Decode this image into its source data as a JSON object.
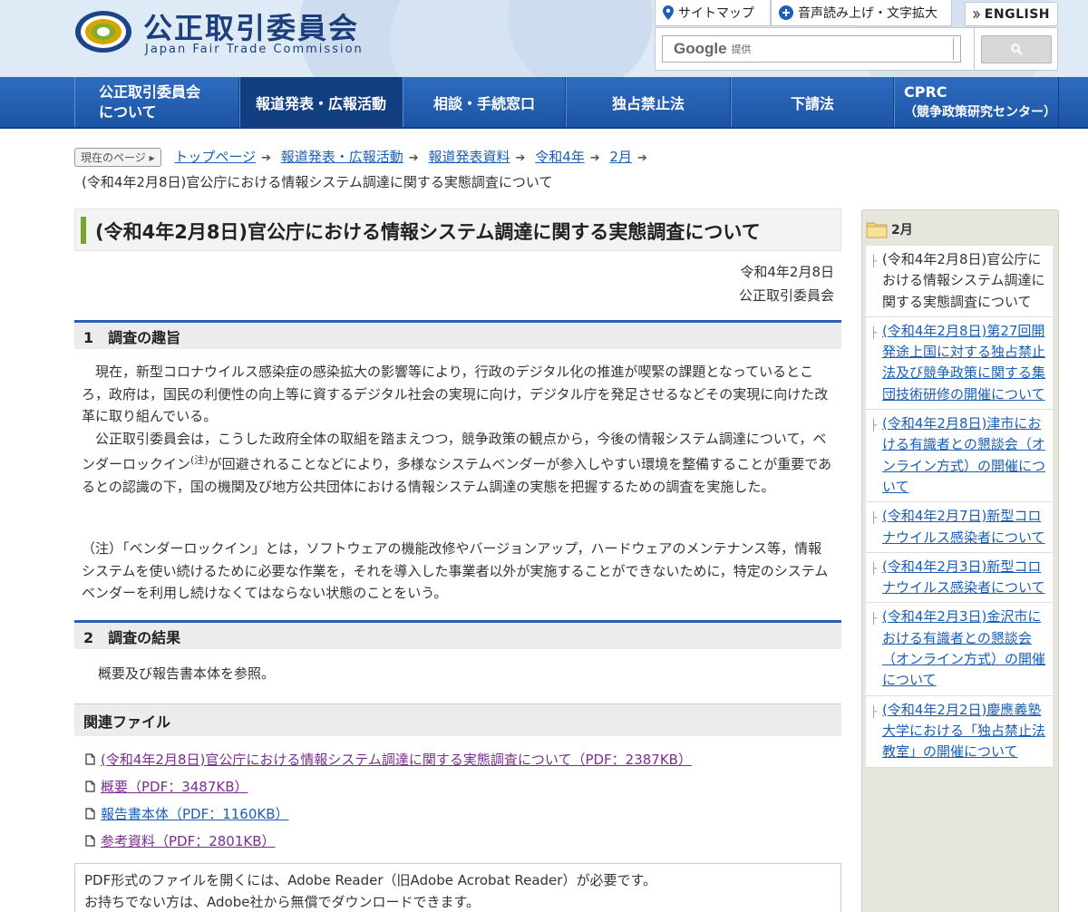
{
  "header": {
    "logo_title": "公正取引委員会",
    "logo_subtitle": "Japan Fair Trade Commission",
    "sitemap_label": "サイトマップ",
    "voice_label": "音声読み上げ・文字拡大",
    "english_label": "ENGLISH",
    "search": {
      "google_word": "Google",
      "provided_label": "提供"
    }
  },
  "nav": {
    "about_line1": "公正取引委員会",
    "about_line2": "について",
    "press": "報道発表・広報活動",
    "consult": "相談・手続窓口",
    "antimonopoly": "独占禁止法",
    "subcontract": "下請法",
    "cprc_line1": "CPRC",
    "cprc_line2": "（競争政策研究センター）"
  },
  "breadcrumb": {
    "badge": "現在のページ",
    "items": [
      "トップページ",
      "報道発表・広報活動",
      "報道発表資料",
      "令和4年",
      "2月"
    ],
    "current": "(令和4年2月8日)官公庁における情報システム調達に関する実態調査について"
  },
  "main": {
    "title": "(令和4年2月8日)官公庁における情報システム調達に関する実態調査について",
    "date": "令和4年2月8日",
    "publisher": "公正取引委員会",
    "section1": {
      "heading": "1　調査の趣旨",
      "para1": "現在，新型コロナウイルス感染症の感染拡大の影響等により，行政のデジタル化の推進が喫緊の課題となっているところ，政府は，国民の利便性の向上等に資するデジタル社会の実現に向け，デジタル庁を発足させるなどその実現に向けた改革に取り組んでいる。",
      "para2_a": "公正取引委員会は，こうした政府全体の取組を踏まえつつ，競争政策の観点から，今後の情報システム調達について，ベンダーロックイン",
      "para2_sup": "(注)",
      "para2_b": "が回避されることなどにより，多様なシステムベンダーが参入しやすい環境を整備することが重要であるとの認識の下，国の機関及び地方公共団体における情報システム調達の実態を把握するための調査を実施した。",
      "note": "（注）「ベンダーロックイン」とは，ソフトウェアの機能改修やバージョンアップ，ハードウェアのメンテナンス等，情報システムを使い続けるために必要な作業を，それを導入した事業者以外が実施することができないために，特定のシステムベンダーを利用し続けなくてはならない状態のことをいう。"
    },
    "section2": {
      "heading": "2　調査の結果",
      "body": "概要及び報告書本体を参照。"
    },
    "related": {
      "heading": "関連ファイル",
      "files": [
        "(令和4年2月8日)官公庁における情報システム調達に関する実態調査について（PDF：2387KB）",
        "概要（PDF：3487KB）",
        "報告書本体（PDF：1160KB）",
        "参考資料（PDF：2801KB）"
      ]
    },
    "pdf_note": {
      "line1": "PDF形式のファイルを開くには、Adobe Reader（旧Adobe Acrobat Reader）が必要です。",
      "line2": "お持ちでない方は、Adobe社から無償でダウンロードできます。"
    }
  },
  "sidebar": {
    "heading": "2月",
    "items": [
      "(令和4年2月8日)官公庁における情報システム調達に関する実態調査について",
      "(令和4年2月8日)第27回開発途上国に対する独占禁止法及び競争政策に関する集団技術研修の開催について",
      "(令和4年2月8日)津市における有識者との懇談会（オンライン方式）の開催について",
      "(令和4年2月7日)新型コロナウイルス感染者について",
      "(令和4年2月3日)新型コロナウイルス感染者について",
      "(令和4年2月3日)金沢市における有識者との懇談会（オンライン方式）の開催について",
      "(令和4年2月2日)慶應義塾大学における「独占禁止法教室」の開催について"
    ]
  },
  "colors": {
    "nav_blue": "#2f6cc0",
    "title_accent": "#7aa52c",
    "section_rule": "#2d5fb0",
    "link": "#1a5fb4",
    "visited_link": "#7b2d8f"
  }
}
